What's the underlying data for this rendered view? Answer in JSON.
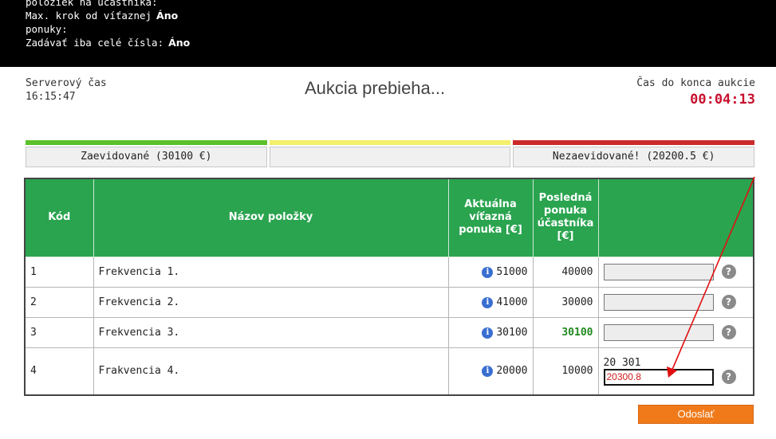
{
  "header": {
    "lines": [
      {
        "label": "položiek na účastníka:",
        "value": ""
      },
      {
        "label": "Max. krok od víťaznej",
        "value": "Áno"
      },
      {
        "label": "ponuky:",
        "value": ""
      },
      {
        "label": "Zadávať iba celé čísla:",
        "value": "Áno"
      }
    ]
  },
  "server_time": {
    "label": "Serverový čas",
    "value": "16:15:47"
  },
  "status_title": "Aukcia prebieha...",
  "countdown": {
    "label": "Čas do konca aukcie",
    "value": "00:04:13"
  },
  "status_bars": [
    {
      "color": "#5cc12a",
      "label": "Zaevidované (30100 €)"
    },
    {
      "color": "#f3ef6a",
      "label": ""
    },
    {
      "color": "#cc2a2a",
      "label": "Nezaevidované! (20200.5 €)"
    }
  ],
  "table": {
    "headers": [
      "Kód",
      "Názov položky",
      "Aktuálna víťazná ponuka [€]",
      "Posledná ponuka účastníka [€]",
      ""
    ],
    "rows": [
      {
        "kod": "1",
        "name": "Frekvencia 1.",
        "current": "51000",
        "last": "40000",
        "last_highlight": false,
        "hint": "",
        "input": ""
      },
      {
        "kod": "2",
        "name": "Frekvencia 2.",
        "current": "41000",
        "last": "30000",
        "last_highlight": false,
        "hint": "",
        "input": ""
      },
      {
        "kod": "3",
        "name": "Frekvencia 3.",
        "current": "30100",
        "last": "30100",
        "last_highlight": true,
        "hint": "",
        "input": ""
      },
      {
        "kod": "4",
        "name": "Frakvencia 4.",
        "current": "20000",
        "last": "10000",
        "last_highlight": false,
        "hint": "20 301",
        "input": "20300.8"
      }
    ]
  },
  "submit_label": "Odoslať",
  "icons": {
    "info": "info-icon",
    "help": "help-icon",
    "arrow": "red-annotation-arrow"
  },
  "colors": {
    "header_green": "#2aa44f",
    "submit_orange": "#f07a1a",
    "countdown_red": "#c8102e",
    "arrow_red": "#e01010"
  }
}
